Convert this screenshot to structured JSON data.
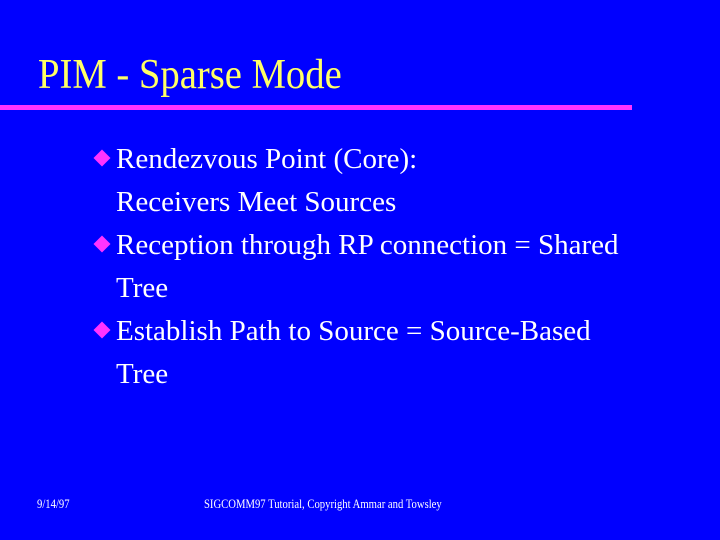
{
  "slide": {
    "title": "PIM - Sparse Mode",
    "bullets": [
      {
        "icon": "diamond-bullet-icon",
        "line1": "Rendezvous Point (Core):",
        "line2": "Receivers Meet Sources"
      },
      {
        "icon": "diamond-bullet-icon",
        "line1": "Reception through RP connection = Shared",
        "line2": "Tree"
      },
      {
        "icon": "diamond-bullet-icon",
        "line1": "Establish Path to Source  = Source-Based",
        "line2": "Tree"
      }
    ],
    "footer": {
      "date": "9/14/97",
      "copyright": "SIGCOMM97 Tutorial, Copyright Ammar and Towsley"
    },
    "colors": {
      "background": "#0000ff",
      "title": "#ffff66",
      "rule": "#ff33ff",
      "bullet": "#ff33ff",
      "text": "#ffffff"
    }
  }
}
